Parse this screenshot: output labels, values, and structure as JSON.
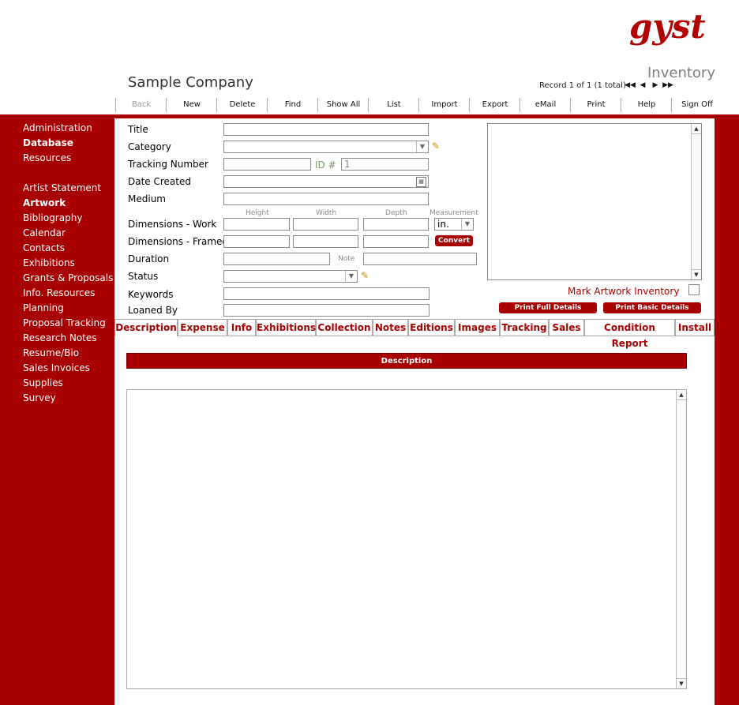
{
  "header": {
    "logo_text": "gyst",
    "module_title": "Inventory",
    "company_name": "Sample Company",
    "record_status": "Record 1 of 1 (1 total)"
  },
  "toolbar": {
    "items": [
      "Back",
      "New",
      "Delete",
      "Find",
      "Show All",
      "List",
      "Import",
      "Export",
      "eMail",
      "Print",
      "Help",
      "Sign Off"
    ]
  },
  "sidebar": {
    "group1": [
      "Administration",
      "Database",
      "Resources"
    ],
    "group2": [
      "Artist Statement",
      "Artwork",
      "Bibliography",
      "Calendar",
      "Contacts",
      "Exhibitions",
      "Grants & Proposals",
      "Info. Resources",
      "Planning",
      "Proposal Tracking",
      "Research Notes",
      "Resume/Bio",
      "Sales Invoices",
      "Supplies",
      "Survey"
    ]
  },
  "form": {
    "title_label": "Title",
    "category_label": "Category",
    "tracking_label": "Tracking Number",
    "id_label": "ID #",
    "id_value": "1",
    "date_label": "Date Created",
    "medium_label": "Medium",
    "height_label": "Height",
    "width_label": "Width",
    "depth_label": "Depth",
    "measurement_label": "Measurement",
    "dim_work_label": "Dimensions - Work",
    "dim_framed_label": "Dimensions - Framed",
    "measurement_value": "in.",
    "convert_label": "Convert",
    "duration_label": "Duration",
    "note_label": "Note",
    "status_label": "Status",
    "keywords_label": "Keywords",
    "loaned_label": "Loaned By"
  },
  "image_panel": {
    "mark_label": "Mark Artwork Inventory",
    "print_full": "Print Full Details",
    "print_basic": "Print Basic Details"
  },
  "tabs": [
    "Description",
    "Expense",
    "Info",
    "Exhibitions",
    "Collection",
    "Notes",
    "Editions",
    "Images",
    "Tracking",
    "Sales",
    "Condition Report",
    "Install"
  ],
  "description": {
    "header": "Description"
  },
  "colors": {
    "brand_red": "#a80000"
  }
}
